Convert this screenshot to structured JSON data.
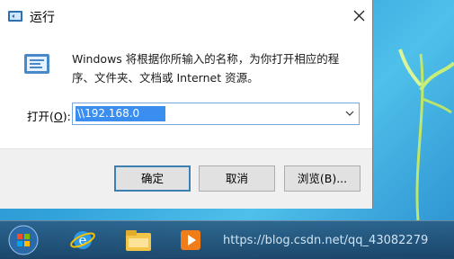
{
  "dialog": {
    "title": "运行",
    "description": "Windows 将根据你所输入的名称，为你打开相应的程序、文件夹、文档或 Internet 资源。",
    "open_label_prefix": "打开(",
    "open_label_key": "O",
    "open_label_suffix": "):",
    "input_value": "\\\\192.168.0",
    "buttons": {
      "ok": "确定",
      "cancel": "取消",
      "browse": "浏览(B)..."
    }
  },
  "taskbar": {
    "icons": [
      "start-orb-icon",
      "internet-explorer-icon",
      "file-explorer-icon",
      "media-player-icon"
    ]
  },
  "watermark": "https://blog.csdn.net/qq_43082279"
}
